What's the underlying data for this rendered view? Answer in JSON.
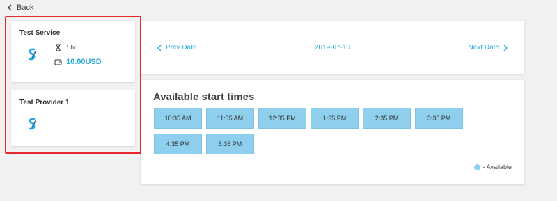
{
  "back": {
    "label": "Back"
  },
  "service": {
    "title": "Test Service",
    "duration": "1 hr.",
    "price": "10.00USD"
  },
  "provider": {
    "title": "Test Provider 1"
  },
  "date_nav": {
    "prev_label": "Prev Date",
    "current_date": "2019-07-10",
    "next_label": "Next Date"
  },
  "times": {
    "title": "Available start times",
    "slots": [
      "10:35 AM",
      "11:35 AM",
      "12:35 PM",
      "1:35 PM",
      "2:35 PM",
      "3:35 PM",
      "4:35 PM",
      "5:35 PM"
    ],
    "legend_label": "- Available"
  },
  "colors": {
    "accent": "#26a9e0",
    "slot": "#8fcfee",
    "highlight": "#e8282f"
  }
}
